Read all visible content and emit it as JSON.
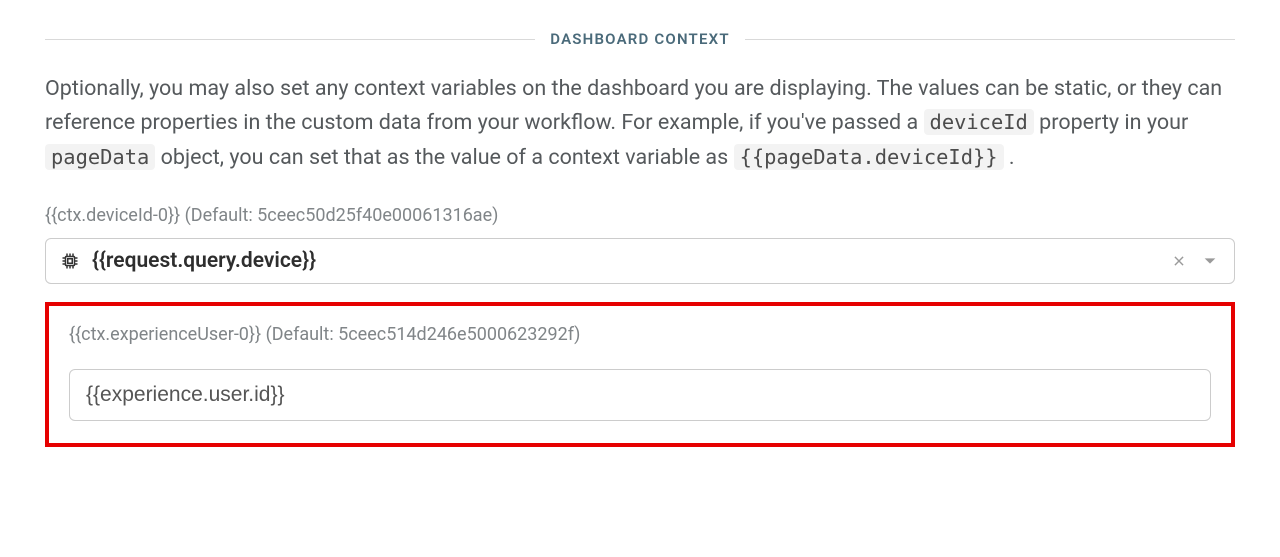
{
  "section": {
    "title": "DASHBOARD CONTEXT",
    "description": {
      "parts": [
        "Optionally, you may also set any context variables on the dashboard you are displaying. The values can be static, or they can reference properties in the custom data from your workflow. For example, if you've passed a ",
        "deviceId",
        " property in your ",
        "pageData",
        " object, you can set that as the value of a context variable as ",
        "{{pageData.deviceId}}",
        "."
      ]
    }
  },
  "fields": {
    "device": {
      "label": "{{ctx.deviceId-0}} (Default: 5ceec50d25f40e00061316ae)",
      "value": "{{request.query.device}}"
    },
    "experienceUser": {
      "label": "{{ctx.experienceUser-0}} (Default: 5ceec514d246e5000623292f)",
      "value": "{{experience.user.id}}"
    }
  }
}
